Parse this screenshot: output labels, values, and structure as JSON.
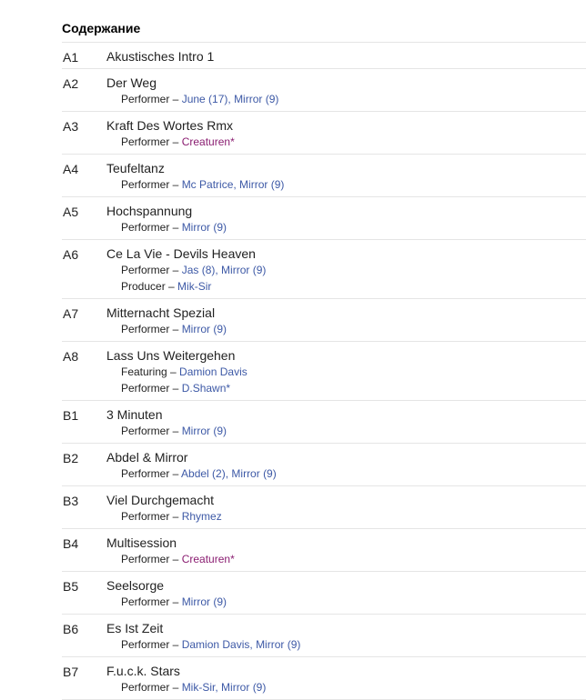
{
  "section": {
    "heading": "Содержание"
  },
  "tracks": [
    {
      "pos": "A1",
      "title": "Akustisches Intro 1",
      "credits": []
    },
    {
      "pos": "A2",
      "title": "Der Weg",
      "credits": [
        {
          "role": "Performer",
          "artists": [
            {
              "name": "June (17)"
            },
            {
              "name": "Mirror (9)"
            }
          ]
        }
      ]
    },
    {
      "pos": "A3",
      "title": "Kraft Des Wortes Rmx",
      "credits": [
        {
          "role": "Performer",
          "artists": [
            {
              "name": "Creaturen",
              "visited": true,
              "suffix": "*"
            }
          ]
        }
      ]
    },
    {
      "pos": "A4",
      "title": "Teufeltanz",
      "credits": [
        {
          "role": "Performer",
          "artists": [
            {
              "name": "Mc Patrice"
            },
            {
              "name": "Mirror (9)"
            }
          ]
        }
      ]
    },
    {
      "pos": "A5",
      "title": "Hochspannung",
      "credits": [
        {
          "role": "Performer",
          "artists": [
            {
              "name": "Mirror (9)"
            }
          ]
        }
      ]
    },
    {
      "pos": "A6",
      "title": "Ce La Vie - Devils Heaven",
      "credits": [
        {
          "role": "Performer",
          "artists": [
            {
              "name": "Jas (8)"
            },
            {
              "name": "Mirror (9)"
            }
          ]
        },
        {
          "role": "Producer",
          "artists": [
            {
              "name": "Mik-Sir"
            }
          ]
        }
      ]
    },
    {
      "pos": "A7",
      "title": "Mitternacht Spezial",
      "credits": [
        {
          "role": "Performer",
          "artists": [
            {
              "name": "Mirror (9)"
            }
          ]
        }
      ]
    },
    {
      "pos": "A8",
      "title": "Lass Uns Weitergehen",
      "credits": [
        {
          "role": "Featuring",
          "artists": [
            {
              "name": "Damion Davis"
            }
          ]
        },
        {
          "role": "Performer",
          "artists": [
            {
              "name": "D.Shawn",
              "suffix": "*"
            }
          ]
        }
      ]
    },
    {
      "pos": "B1",
      "title": "3 Minuten",
      "credits": [
        {
          "role": "Performer",
          "artists": [
            {
              "name": "Mirror (9)"
            }
          ]
        }
      ]
    },
    {
      "pos": "B2",
      "title": "Abdel & Mirror",
      "credits": [
        {
          "role": "Performer",
          "artists": [
            {
              "name": "Abdel (2)"
            },
            {
              "name": "Mirror (9)"
            }
          ]
        }
      ]
    },
    {
      "pos": "B3",
      "title": "Viel Durchgemacht",
      "credits": [
        {
          "role": "Performer",
          "artists": [
            {
              "name": "Rhymez"
            }
          ]
        }
      ]
    },
    {
      "pos": "B4",
      "title": "Multisession",
      "credits": [
        {
          "role": "Performer",
          "artists": [
            {
              "name": "Creaturen",
              "visited": true,
              "suffix": "*"
            }
          ]
        }
      ]
    },
    {
      "pos": "B5",
      "title": "Seelsorge",
      "credits": [
        {
          "role": "Performer",
          "artists": [
            {
              "name": "Mirror (9)"
            }
          ]
        }
      ]
    },
    {
      "pos": "B6",
      "title": "Es Ist Zeit",
      "credits": [
        {
          "role": "Performer",
          "artists": [
            {
              "name": "Damion Davis"
            },
            {
              "name": "Mirror (9)"
            }
          ]
        }
      ]
    },
    {
      "pos": "B7",
      "title": "F.u.c.k. Stars",
      "credits": [
        {
          "role": "Performer",
          "artists": [
            {
              "name": "Mik-Sir"
            },
            {
              "name": "Mirror (9)"
            }
          ]
        }
      ]
    }
  ],
  "labels": {
    "dash": " – ",
    "separator": ", "
  },
  "colors": {
    "link": "#3d59a6",
    "visited": "#8a1d71"
  }
}
